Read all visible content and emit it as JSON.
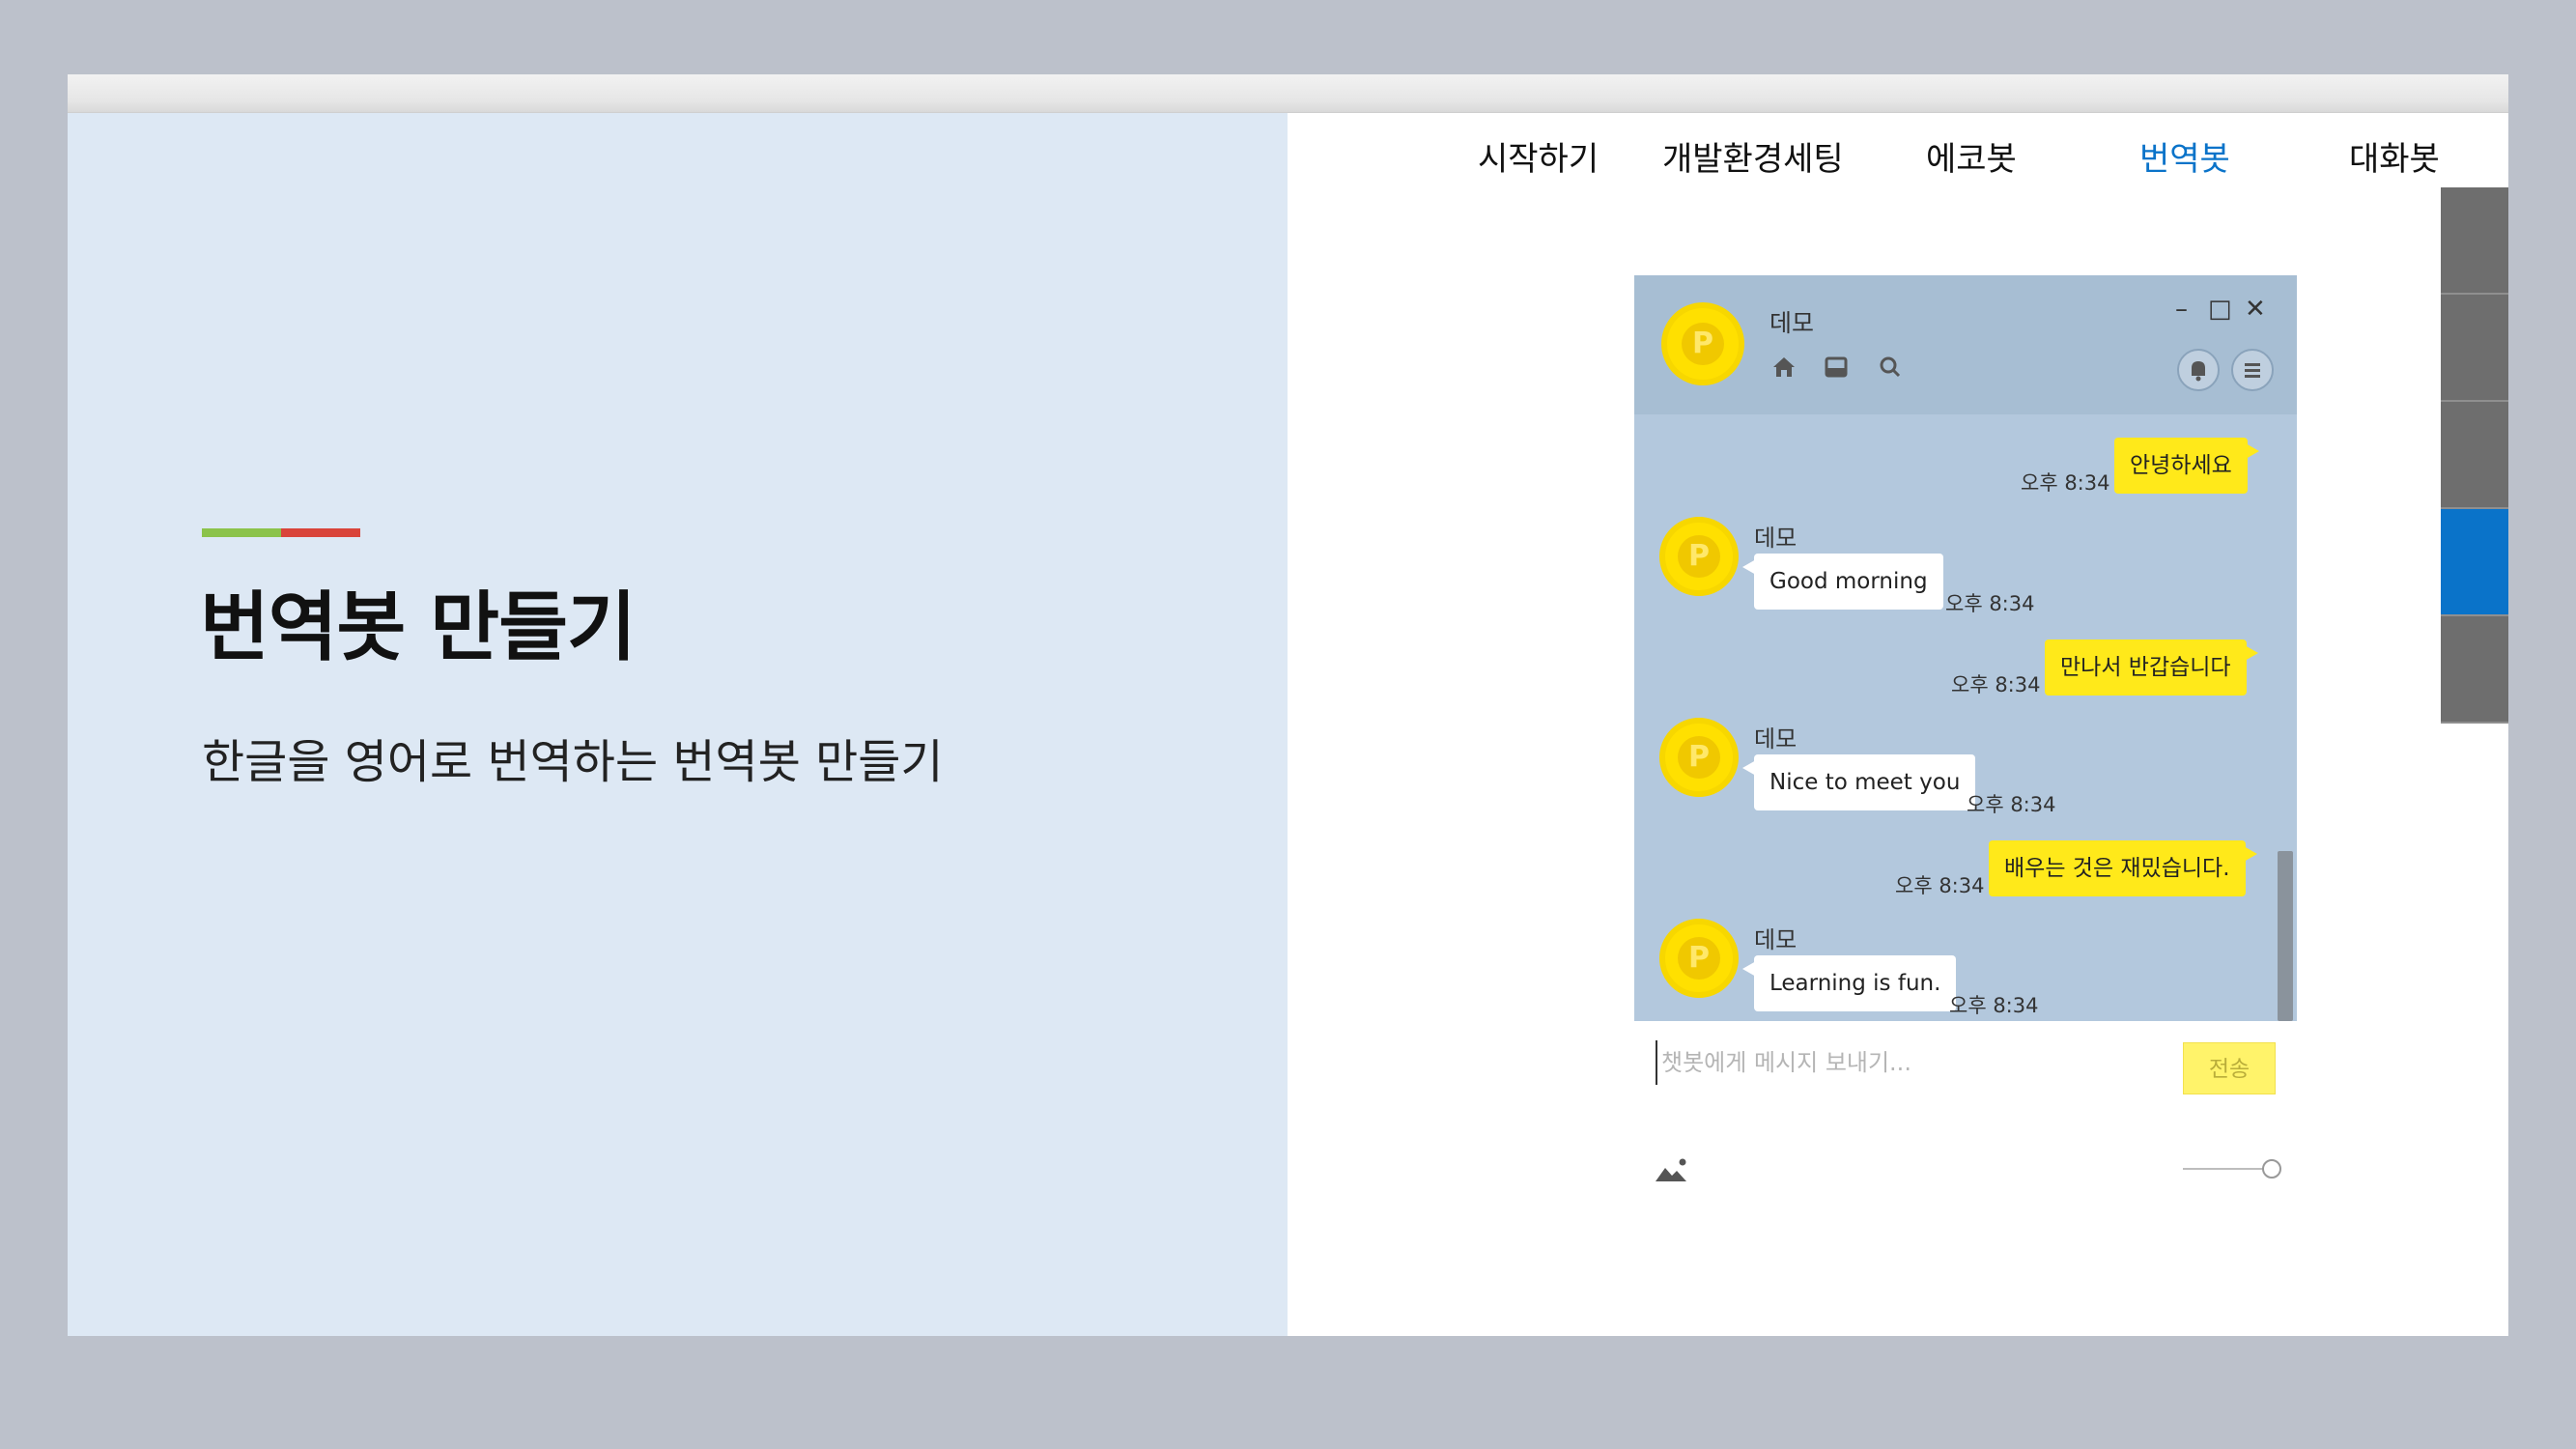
{
  "slide": {
    "title": "번역봇 만들기",
    "subtitle": "한글을 영어로 번역하는 번역봇 만들기"
  },
  "nav": {
    "items": [
      {
        "label": "시작하기"
      },
      {
        "label": "개발환경세팅"
      },
      {
        "label": "에코봇"
      },
      {
        "label": "번역봇",
        "active": true
      },
      {
        "label": "대화봇"
      }
    ],
    "active_color": "#0a73c9"
  },
  "chat": {
    "window_name": "데모",
    "messages": [
      {
        "from": "me",
        "text": "안녕하세요",
        "time": "오후 8:34"
      },
      {
        "from": "bot",
        "name": "데모",
        "text": "Good morning",
        "time": "오후 8:34"
      },
      {
        "from": "me",
        "text": "만나서 반갑습니다",
        "time": "오후 8:34"
      },
      {
        "from": "bot",
        "name": "데모",
        "text": "Nice to meet you",
        "time": "오후 8:34"
      },
      {
        "from": "me",
        "text": "배우는 것은 재밌습니다.",
        "time": "오후 8:34"
      },
      {
        "from": "bot",
        "name": "데모",
        "text": "Learning is fun.",
        "time": "오후 8:34"
      }
    ],
    "input_placeholder": "챗봇에게 메시지 보내기...",
    "send_label": "전송",
    "bubble_me_color": "#ffe91a",
    "bubble_bot_color": "#ffffff",
    "background_color": "#b3c8dd"
  },
  "icons": {
    "home": "home-icon",
    "inbox": "inbox-icon",
    "search": "search-icon",
    "bell": "bell-icon",
    "menu": "menu-icon",
    "image": "image-icon"
  }
}
